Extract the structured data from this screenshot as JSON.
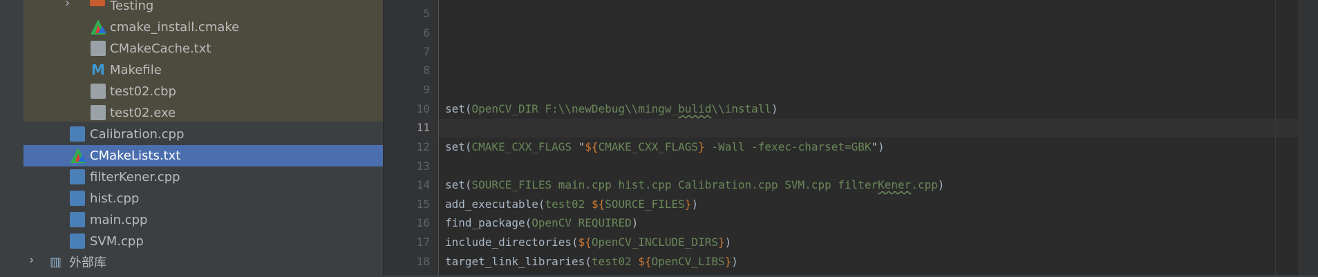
{
  "project_tree": {
    "rows": [
      {
        "label": "Testing"
      },
      {
        "label": "cmake_install.cmake"
      },
      {
        "label": "CMakeCache.txt"
      },
      {
        "label": "Makefile"
      },
      {
        "label": "test02.cbp"
      },
      {
        "label": "test02.exe"
      },
      {
        "label": "Calibration.cpp"
      },
      {
        "label": "CMakeLists.txt"
      },
      {
        "label": "filterKener.cpp"
      },
      {
        "label": "hist.cpp"
      },
      {
        "label": "main.cpp"
      },
      {
        "label": "SVM.cpp"
      },
      {
        "label": "外部库"
      }
    ],
    "selected": "CMakeLists.txt"
  },
  "editor": {
    "line_numbers": [
      "5",
      "6",
      "7",
      "8",
      "9",
      "10",
      "11",
      "12",
      "13",
      "14",
      "15",
      "16",
      "17",
      "18"
    ],
    "current_line": "11",
    "lines": {
      "l10": {
        "fn": "set(",
        "args": "OpenCV_DIR F:\\\\newDebug\\\\mingw_",
        "typo": "bulid",
        "args2": "\\\\install",
        "close": ")"
      },
      "l12": {
        "fn": "set(",
        "a1": "CMAKE_CXX_FLAGS ",
        "q1": "\"",
        "v1": "${",
        "a2": "CMAKE_CXX_FLAGS",
        "v2": "}",
        "a3": " -Wall -fexec-charset=GBK",
        "q2": "\"",
        "close": ")"
      },
      "l14": {
        "fn": "set(",
        "args": "SOURCE_FILES main.cpp hist.cpp Calibration.cpp SVM.cpp filter",
        "typo": "Kener",
        "args2": ".cpp",
        "close": ")"
      },
      "l15": {
        "fn": "add_executable(",
        "a1": "test02 ",
        "v1": "${",
        "a2": "SOURCE_FILES",
        "v2": "}",
        "close": ")"
      },
      "l16": {
        "fn": "find_package(",
        "args": "OpenCV REQUIRED",
        "close": ")"
      },
      "l17": {
        "fn": "include_directories(",
        "v1": "${",
        "a2": "OpenCV_INCLUDE_DIRS",
        "v2": "}",
        "close": ")"
      },
      "l18": {
        "fn": "target_link_libraries(",
        "a1": "test02 ",
        "v1": "${",
        "a2": "OpenCV_LIBS",
        "v2": "}",
        "close": ")"
      }
    }
  },
  "icons": {
    "folder": "folder-icon",
    "cmake": "cmake-icon",
    "text_file": "text-settings-file-icon",
    "makefile": "makefile-icon",
    "file": "file-icon",
    "exe": "unknown-file-icon",
    "cpp": "cpp-file-icon",
    "library": "library-icon",
    "chevron": "chevron-right-icon"
  },
  "colors": {
    "selection": "#4b6eaf",
    "build_folder_bg": "#4d4a3e",
    "keyword_string": "#6a8759",
    "variable": "#cc7832"
  }
}
